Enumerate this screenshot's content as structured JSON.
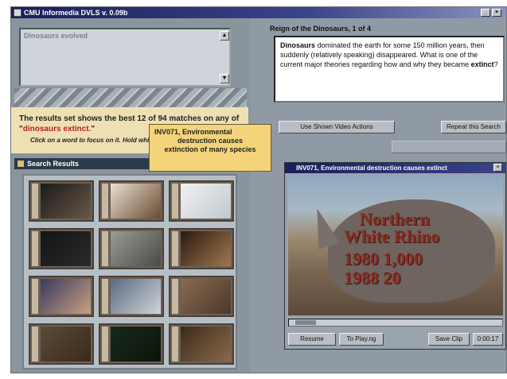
{
  "app": {
    "title": "CMU Informedia DVLS v. 0.09b"
  },
  "description_box": {
    "text": "Dinosaurs evolved"
  },
  "results_banner": {
    "summary_prefix": "The results set shows the best 12 of 94 matches on any of \"",
    "query_terms": "dinosaurs extinct.",
    "summary_suffix": "\"",
    "instruction": "Click on a word to focus on it. Hold while clicking to have only"
  },
  "tooltip": {
    "line1": "INV071, Environmental",
    "line2": "destruction causes",
    "line3": "extinction of many species"
  },
  "search_results": {
    "header": "Search Results",
    "thumbnails": [
      {
        "colors": [
          "#1a1a1a",
          "#6a5848"
        ]
      },
      {
        "colors": [
          "#e8e0d0",
          "#6a4a30"
        ]
      },
      {
        "colors": [
          "#f2f2f0",
          "#c0c8d0"
        ]
      },
      {
        "colors": [
          "#151515",
          "#2a2a2a"
        ]
      },
      {
        "colors": [
          "#9a9a96",
          "#4a4a46"
        ]
      },
      {
        "colors": [
          "#2a1a10",
          "#a07850"
        ]
      },
      {
        "colors": [
          "#3a3a60",
          "#c8a080"
        ]
      },
      {
        "colors": [
          "#5a6a80",
          "#d0d4d8"
        ]
      },
      {
        "colors": [
          "#8a6a50",
          "#4a3a2a"
        ]
      },
      {
        "colors": [
          "#5a4a3a",
          "#3a2a1a"
        ]
      },
      {
        "colors": [
          "#1a2a1a",
          "#0a140a"
        ]
      },
      {
        "colors": [
          "#3a2a1a",
          "#8a6a4a"
        ]
      }
    ]
  },
  "reign": {
    "title": "Reign of the Dinosaurs, 1 of 4",
    "term1": "Dinosaurs",
    "body1": " dominated the earth for some 150 million years, then suddenly (relatively speaking) disappeared. What is one of the current major theories regarding how and why they became ",
    "term2": "extinct",
    "body2": "?"
  },
  "buttons": {
    "chosen_videos": "Use Shown Video Actions",
    "repeat_search": "Repeat this Search",
    "disabled": ""
  },
  "video": {
    "title": "INV071, Environmental destruction causes extinct",
    "overlay": [
      "Northern",
      "White Rhino",
      "1980  1,000",
      "1988     20"
    ],
    "controls": [
      "Resume",
      "To Play.ng",
      "Save Clip",
      "0:00:17"
    ]
  },
  "colors": {
    "accent_text": "#b82222",
    "banner_bg": "#efe0b4",
    "tooltip_bg": "#f4d47a"
  }
}
